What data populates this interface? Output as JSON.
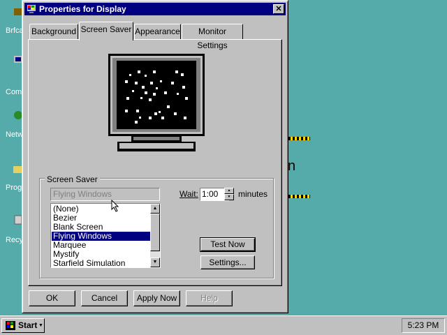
{
  "desktop": {
    "icons": [
      {
        "label": "Brfca",
        "icon": "briefcase-icon"
      },
      {
        "label": "Comp",
        "icon": "my-computer-icon"
      },
      {
        "label": "Netw",
        "icon": "network-icon"
      },
      {
        "label": "Prog",
        "icon": "folder-icon"
      },
      {
        "label": "Recy",
        "icon": "recycle-bin-icon"
      }
    ],
    "background_fragment": "n",
    "colors": {
      "desktop": "#55aaaa",
      "titlebar": "#000080",
      "face": "#c0c0c0",
      "selection": "#000080"
    }
  },
  "dialog": {
    "title": "Properties for Display",
    "close_glyph": "✕",
    "tabs": [
      {
        "label": "Background"
      },
      {
        "label": "Screen Saver"
      },
      {
        "label": "Appearance"
      },
      {
        "label": "Monitor Settings"
      }
    ],
    "active_tab": "Screen Saver",
    "screen_saver": {
      "group_label": "Screen Saver",
      "selected_value": "Flying Windows",
      "list_items": [
        "(None)",
        "Bezier",
        "Blank Screen",
        "Flying Windows",
        "Marquee",
        "Mystify",
        "Starfield Simulation"
      ],
      "selected_index": 3,
      "wait_label": "Wait:",
      "wait_value": "1:00",
      "wait_unit": "minutes",
      "test_now_label": "Test Now",
      "settings_label": "Settings..."
    },
    "buttons": {
      "ok": "OK",
      "cancel": "Cancel",
      "apply_now": "Apply Now",
      "help": "Help"
    }
  },
  "taskbar": {
    "start_label": "Start",
    "clock": "5:23 PM"
  }
}
